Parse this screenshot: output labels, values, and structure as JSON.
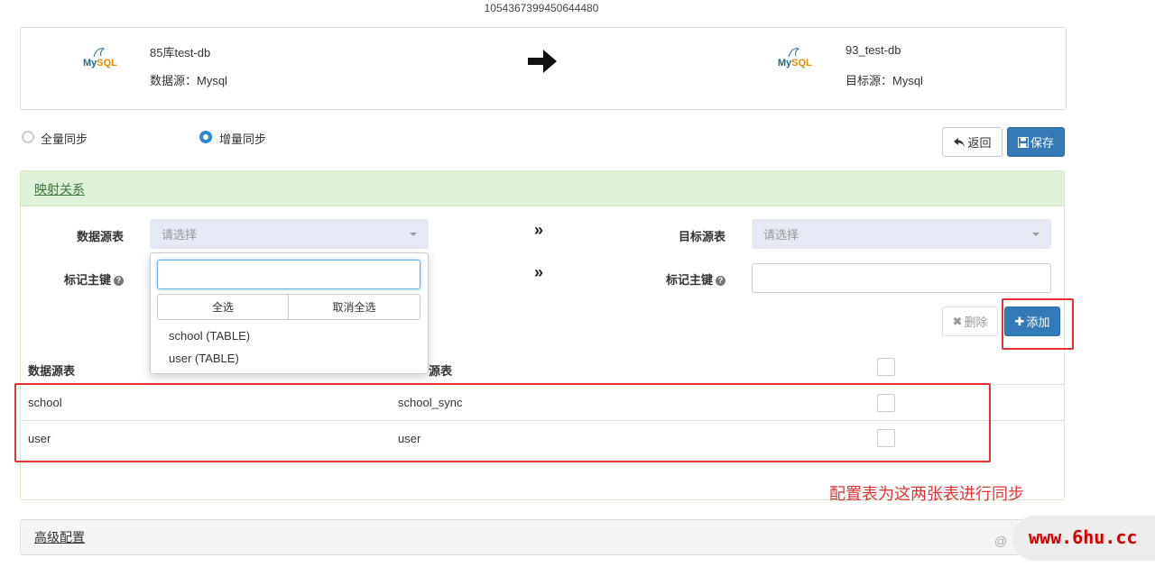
{
  "job_id": "1054367399450644480",
  "source": {
    "name": "85库test-db",
    "type_label": "数据源：Mysql",
    "logo_my": "My",
    "logo_sql": "SQL"
  },
  "target": {
    "name": "93_test-db",
    "type_label": "目标源：Mysql",
    "logo_my": "My",
    "logo_sql": "SQL"
  },
  "sync_mode": {
    "full_label": "全量同步",
    "incremental_label": "增量同步",
    "selected": "incremental"
  },
  "actions": {
    "back_label": "返回",
    "save_label": "保存"
  },
  "mapping": {
    "title": "映射关系",
    "source_table_label": "数据源表",
    "target_table_label": "目标源表",
    "source_pk_label": "标记主键",
    "target_pk_label": "标记主键",
    "source_placeholder": "请选择",
    "target_placeholder": "请选择",
    "delete_label": "删除",
    "add_label": "添加"
  },
  "dropdown": {
    "select_all": "全选",
    "deselect_all": "取消全选",
    "options": [
      "school (TABLE)",
      "user (TABLE)"
    ]
  },
  "table": {
    "col_source": "数据源表",
    "col_target_visible": "源表",
    "rows": [
      {
        "source": "school",
        "target": "school_sync"
      },
      {
        "source": "user",
        "target": "user"
      }
    ]
  },
  "annotation": "配置表为这两张表进行同步",
  "advanced_title": "高级配置",
  "watermark": {
    "at": "@",
    "text": "www.6hu.cc"
  },
  "colors": {
    "primary": "#337ab7",
    "panel_header": "#dff0d8",
    "annotation_red": "#e53333"
  }
}
